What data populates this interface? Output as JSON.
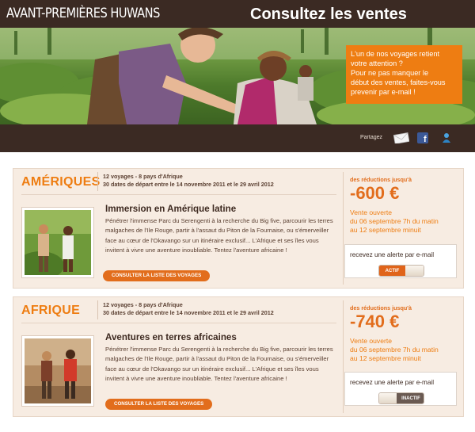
{
  "header": {
    "brand": "AVANT-PREMIÈRES HUWANS",
    "title": "Consultez les ventes"
  },
  "promo": {
    "line1": "L'un de nos voyages retient",
    "line2": "votre attention ?",
    "line3": "Pour ne pas manquer le",
    "line4": "début des ventes, faites-vous",
    "line5": "prevenir par e-mail !"
  },
  "share": {
    "label": "Partagez",
    "icons": [
      "email-icon",
      "facebook-icon",
      "share-icon"
    ]
  },
  "sales": [
    {
      "region": "AMÉRIQUES",
      "meta_line1": "12 voyages - 8 pays d'Afrique",
      "meta_line2": "30 dates de départ entre le 14 novembre 2011 et le 29 avril 2012",
      "trip_title": "Immersion en Amérique latine",
      "description": "Pénétrer l'immense Parc du Serengenti à la recherche du Big five, parcourir les terres malgaches de l'Ile Rouge, partir à l'assaut du Piton de la Fournaise, ou s'émerveiller face au cœur de l'Okavango sur un itinéraire exclusif... L'Afrique et ses îles vous invitent à vivre une aventure inoubliable. Tentez l'aventure africaine !",
      "list_button": "CONSULTER LA LISTE DES VOYAGES",
      "discount_label": "des réductions jusqu'à",
      "discount_value": "-600 €",
      "sale_line1": "Vente ouverte",
      "sale_line2": "du 06 septembre 7h du matin",
      "sale_line3": "au 12 septembre minuit",
      "alert_label": "recevez une alerte par e-mail",
      "toggle_label": "ACTIF",
      "toggle_state": "on"
    },
    {
      "region": "AFRIQUE",
      "meta_line1": "12 voyages - 8 pays d'Afrique",
      "meta_line2": "30 dates de départ entre le 14 novembre 2011 et le 29 avril 2012",
      "trip_title": "Aventures en terres africaines",
      "description": "Pénétrer l'immense Parc du Serengenti à la recherche du Big five, parcourir les terres malgaches de l'Ile Rouge, partir à l'assaut du Piton de la Fournaise, ou s'émerveiller face au cœur de l'Okavango sur un itinéraire exclusif... L'Afrique et ses îles vous invitent à vivre une aventure inoubliable. Tentez l'aventure africaine !",
      "list_button": "CONSULTER LA LISTE DES VOYAGES",
      "discount_label": "des réductions jusqu'à",
      "discount_value": "-740 €",
      "sale_line1": "Vente ouverte",
      "sale_line2": "du 06 septembre 7h du matin",
      "sale_line3": "au 12 septembre minuit",
      "alert_label": "recevez une alerte par e-mail",
      "toggle_label": "INACTIF",
      "toggle_state": "off"
    }
  ],
  "colors": {
    "brand_dark": "#3b2a23",
    "accent_orange": "#ee7d12",
    "card_bg": "#f7ece2"
  }
}
